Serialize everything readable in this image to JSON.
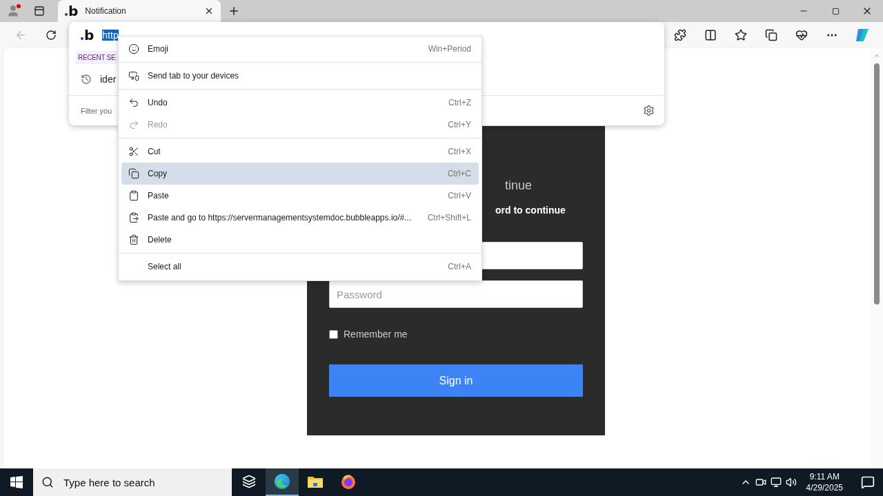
{
  "tabs": [
    {
      "title": "Notification",
      "favicon": "b",
      "selected": true
    }
  ],
  "address_bar": {
    "site_icon": "b",
    "url": "http",
    "url_selected": true
  },
  "omnibox": {
    "section_label": "RECENT SE",
    "recent": [
      {
        "text": "ider"
      }
    ],
    "filter_placeholder": "Filter you"
  },
  "context_menu": {
    "items": [
      {
        "kind": "item",
        "label": "Emoji",
        "shortcut": "Win+Period",
        "disabled": false,
        "selected": false
      },
      {
        "kind": "divider"
      },
      {
        "kind": "item",
        "label": "Send tab to your devices",
        "disabled": false,
        "selected": false
      },
      {
        "kind": "divider"
      },
      {
        "kind": "item",
        "label": "Undo",
        "shortcut": "Ctrl+Z",
        "disabled": false,
        "selected": false
      },
      {
        "kind": "item",
        "label": "Redo",
        "shortcut": "Ctrl+Y",
        "disabled": true,
        "selected": false
      },
      {
        "kind": "divider"
      },
      {
        "kind": "item",
        "label": "Cut",
        "shortcut": "Ctrl+X",
        "disabled": false,
        "selected": false
      },
      {
        "kind": "item",
        "label": "Copy",
        "shortcut": "Ctrl+C",
        "disabled": false,
        "selected": true
      },
      {
        "kind": "item",
        "label": "Paste",
        "shortcut": "Ctrl+V",
        "disabled": false,
        "selected": false
      },
      {
        "kind": "item",
        "label": "Paste and go to https://servermanagementsystemdoc.bubbleapps.io/#...",
        "shortcut": "Ctrl+Shift+L",
        "disabled": false,
        "selected": false
      },
      {
        "kind": "item",
        "label": "Delete",
        "disabled": false,
        "selected": false
      },
      {
        "kind": "divider"
      },
      {
        "kind": "item",
        "label": "Select all",
        "shortcut": "Ctrl+A",
        "disabled": false,
        "selected": false
      }
    ]
  },
  "page": {
    "title": "tinue",
    "subtitle": "ord to continue",
    "fields": [
      {
        "placeholder": "Password"
      }
    ],
    "remember": {
      "label": "Remember me",
      "checked": false
    },
    "submit": "Sign in"
  },
  "taskbar": {
    "search_placeholder": "Type here to search",
    "apps": [
      {
        "kind": "task_view",
        "selected": false
      },
      {
        "kind": "edge",
        "selected": true
      },
      {
        "kind": "explorer",
        "selected": false
      },
      {
        "kind": "firefox",
        "selected": false
      }
    ],
    "time": "9:11 AM",
    "date": "4/29/2025"
  }
}
